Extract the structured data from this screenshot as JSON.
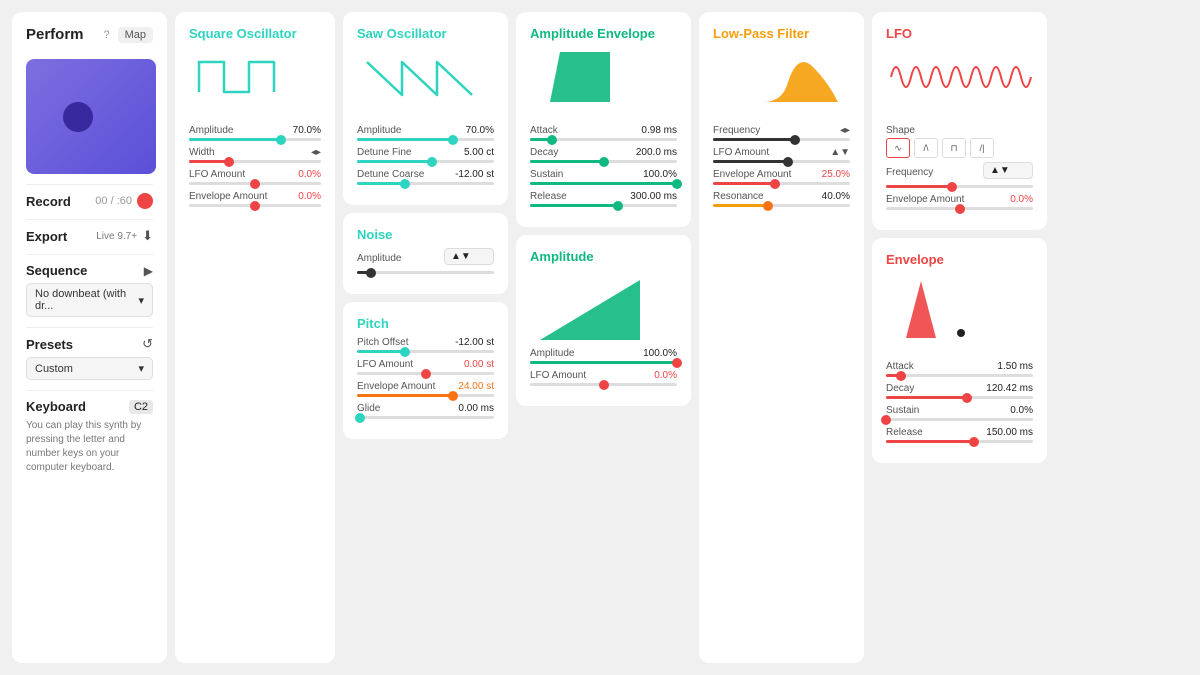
{
  "left": {
    "perform": "Perform",
    "help": "?",
    "map": "Map",
    "record": "Record",
    "record_time": "00 / :60",
    "export": "Export",
    "export_version": "Live 9.7+",
    "sequence": "Sequence",
    "no_downbeat": "No downbeat (with dr...",
    "presets": "Presets",
    "custom": "Custom",
    "keyboard": "Keyboard",
    "keyboard_note": "C2",
    "keyboard_help": "You can play this synth by pressing the letter and number keys on your computer keyboard."
  },
  "square_osc": {
    "title": "Square Oscillator",
    "amplitude_label": "Amplitude",
    "amplitude_value": "70.0%",
    "amplitude_pct": 70,
    "width_label": "Width",
    "lfo_amount_label": "LFO Amount",
    "lfo_amount_value": "0.0%",
    "lfo_pct": 0,
    "env_amount_label": "Envelope Amount",
    "env_amount_value": "0.0%",
    "env_pct": 0
  },
  "saw_osc": {
    "title": "Saw Oscillator",
    "amplitude_label": "Amplitude",
    "amplitude_value": "70.0%",
    "amplitude_pct": 70,
    "detune_fine_label": "Detune Fine",
    "detune_fine_value": "5.00 ct",
    "detune_fine_pct": 55,
    "detune_coarse_label": "Detune Coarse",
    "detune_coarse_value": "-12.00 st",
    "detune_coarse_pct": 35,
    "noise_title": "Noise",
    "noise_amplitude_label": "Amplitude",
    "noise_amplitude_pct": 10
  },
  "amp_env": {
    "title": "Amplitude Envelope",
    "attack_label": "Attack",
    "attack_value": "0.98 ms",
    "attack_pct": 15,
    "decay_label": "Decay",
    "decay_value": "200.0 ms",
    "decay_pct": 50,
    "sustain_label": "Sustain",
    "sustain_value": "100.0%",
    "sustain_pct": 100,
    "release_label": "Release",
    "release_value": "300.00 ms",
    "release_pct": 60,
    "amplitude_title": "Amplitude",
    "amplitude_label": "Amplitude",
    "amplitude_value": "100.0%",
    "amplitude_pct": 100,
    "lfo_amount_label": "LFO Amount",
    "lfo_amount_value": "0.0%",
    "lfo_pct": 0
  },
  "lpf": {
    "title": "Low-Pass Filter",
    "frequency_label": "Frequency",
    "lfo_amount_label": "LFO Amount",
    "env_amount_label": "Envelope Amount",
    "env_amount_value": "25.0%",
    "env_pct": 45,
    "resonance_label": "Resonance",
    "resonance_value": "40.0%",
    "resonance_pct": 40
  },
  "lfo": {
    "title": "LFO",
    "shape_label": "Shape",
    "frequency_label": "Frequency",
    "env_amount_label": "Envelope Amount",
    "env_amount_value": "0.0%",
    "env_pct": 50,
    "envelope_title": "Envelope",
    "attack_label": "Attack",
    "attack_value": "1.50 ms",
    "attack_pct": 10,
    "decay_label": "Decay",
    "decay_value": "120.42 ms",
    "decay_pct": 55,
    "sustain_label": "Sustain",
    "sustain_value": "0.0%",
    "sustain_pct": 0,
    "release_label": "Release",
    "release_value": "150.00 ms",
    "release_pct": 60
  },
  "pitch": {
    "title": "Pitch",
    "pitch_offset_label": "Pitch Offset",
    "pitch_offset_value": "-12.00 st",
    "pitch_offset_pct": 35,
    "lfo_amount_label": "LFO Amount",
    "lfo_amount_value": "0.00 st",
    "lfo_pct": 50,
    "env_amount_label": "Envelope Amount",
    "env_amount_value": "24.00 st",
    "env_pct": 70,
    "glide_label": "Glide",
    "glide_value": "0.00 ms",
    "glide_pct": 2
  }
}
